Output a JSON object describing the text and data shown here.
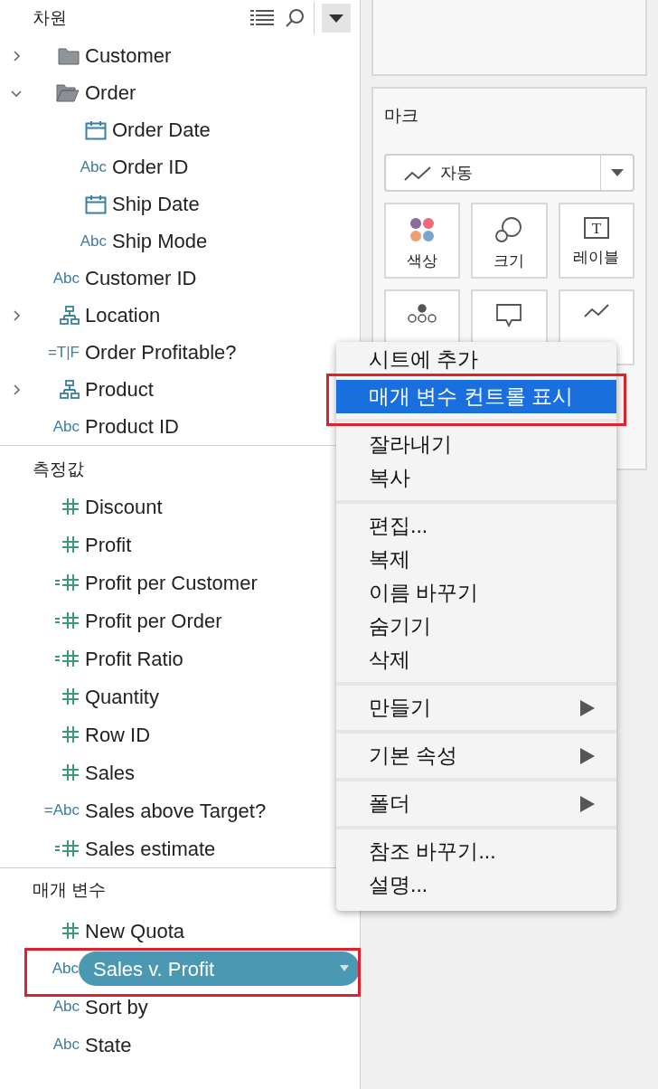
{
  "dimensions": {
    "title": "차원",
    "items": [
      {
        "kind": "folder",
        "label": "Customer",
        "expanded": false
      },
      {
        "kind": "folder",
        "label": "Order",
        "expanded": true,
        "children": [
          {
            "kind": "date",
            "label": "Order Date"
          },
          {
            "kind": "string",
            "type_label": "Abc",
            "label": "Order ID"
          },
          {
            "kind": "date",
            "label": "Ship Date"
          },
          {
            "kind": "string",
            "type_label": "Abc",
            "label": "Ship Mode"
          }
        ]
      },
      {
        "kind": "string",
        "type_label": "Abc",
        "label": "Customer ID"
      },
      {
        "kind": "hierarchy",
        "label": "Location",
        "expanded": false
      },
      {
        "kind": "string",
        "type_label": "=T|F",
        "label": "Order Profitable?"
      },
      {
        "kind": "hierarchy",
        "label": "Product",
        "expanded": false
      },
      {
        "kind": "string",
        "type_label": "Abc",
        "label": "Product ID"
      }
    ]
  },
  "measures": {
    "title": "측정값",
    "items": [
      {
        "kind": "number",
        "label": "Discount"
      },
      {
        "kind": "number",
        "label": "Profit"
      },
      {
        "kind": "calc-number",
        "label": "Profit per Customer"
      },
      {
        "kind": "calc-number",
        "label": "Profit per Order"
      },
      {
        "kind": "calc-number",
        "label": "Profit Ratio"
      },
      {
        "kind": "number",
        "label": "Quantity"
      },
      {
        "kind": "number",
        "label": "Row ID"
      },
      {
        "kind": "number",
        "label": "Sales"
      },
      {
        "kind": "string",
        "type_label": "=Abc",
        "label": "Sales above Target?"
      },
      {
        "kind": "calc-number",
        "label": "Sales estimate"
      }
    ]
  },
  "parameters": {
    "title": "매개 변수",
    "items": [
      {
        "kind": "number",
        "label": "New Quota",
        "selected": false
      },
      {
        "kind": "string",
        "type_label": "Abc",
        "label": "Sales v. Profit",
        "selected": true
      },
      {
        "kind": "string",
        "type_label": "Abc",
        "label": "Sort by",
        "selected": false
      },
      {
        "kind": "string",
        "type_label": "Abc",
        "label": "State",
        "selected": false
      }
    ]
  },
  "marks": {
    "title": "마크",
    "mark_type": "자동",
    "cards": [
      {
        "kind": "color",
        "label": "색상"
      },
      {
        "kind": "size",
        "label": "크기"
      },
      {
        "kind": "text",
        "icon_text": "T",
        "label": "레이블"
      },
      {
        "kind": "detail"
      },
      {
        "kind": "tooltip"
      },
      {
        "kind": "path"
      }
    ]
  },
  "context_menu": {
    "groups": [
      [
        {
          "label": "시트에 추가",
          "selected": false
        },
        {
          "label": "매개 변수 컨트롤 표시",
          "selected": true
        }
      ],
      [
        {
          "label": "잘라내기",
          "selected": false
        },
        {
          "label": "복사",
          "selected": false
        }
      ],
      [
        {
          "label": "편집...",
          "selected": false
        },
        {
          "label": "복제",
          "selected": false
        },
        {
          "label": "이름 바꾸기",
          "selected": false
        },
        {
          "label": "숨기기",
          "selected": false
        },
        {
          "label": "삭제",
          "selected": false
        }
      ],
      [
        {
          "label": "만들기",
          "selected": false,
          "submenu": true
        }
      ],
      [
        {
          "label": "기본 속성",
          "selected": false,
          "submenu": true
        }
      ],
      [
        {
          "label": "폴더",
          "selected": false,
          "submenu": true
        }
      ],
      [
        {
          "label": "참조 바꾸기...",
          "selected": false
        },
        {
          "label": "설명...",
          "selected": false
        }
      ]
    ]
  }
}
